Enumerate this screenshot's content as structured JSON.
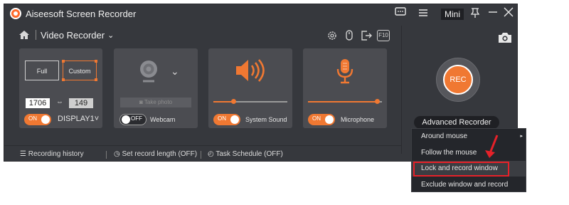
{
  "app": {
    "title": "Aiseesoft Screen Recorder"
  },
  "titlebar": {
    "mini_label": "Mini",
    "icons": [
      "feedback-icon",
      "menu-icon",
      "pin-icon",
      "minimize-icon",
      "close-icon"
    ]
  },
  "nav": {
    "title": "Video Recorder",
    "chevron": "⌄"
  },
  "toolbar": {
    "icons": [
      "settings-icon",
      "mouse-icon",
      "export-icon",
      "f10-icon"
    ],
    "f10_label": "F10"
  },
  "display_card": {
    "full_label": "Full",
    "custom_label": "Custom",
    "width": "1706",
    "height": "149",
    "link_glyph": "⇔",
    "toggle_label": "ON",
    "display_label": "DISPLAY1",
    "display_chev": "˅"
  },
  "webcam_card": {
    "photo_label": "Take photo",
    "toggle_label": "OFF",
    "label": "Webcam",
    "chevron": "⌄"
  },
  "sound_card": {
    "toggle_label": "ON",
    "label": "System Sound",
    "volume_percent": 27
  },
  "mic_card": {
    "toggle_label": "ON",
    "label": "Microphone",
    "volume_percent": 93
  },
  "bottom": {
    "history": "Recording history",
    "record_length": "Set record length (OFF)",
    "task_schedule": "Task Schedule (OFF)"
  },
  "rec_label": "REC",
  "advanced_recorder": "Advanced Recorder",
  "menu": {
    "items": [
      {
        "label": "Around mouse",
        "has_submenu": true
      },
      {
        "label": "Follow the mouse",
        "has_submenu": false
      },
      {
        "label": "Lock and record window",
        "has_submenu": false
      },
      {
        "label": "Exclude window and record",
        "has_submenu": false
      }
    ],
    "submenu_glyph": "▸"
  },
  "colors": {
    "accent": "#f07832",
    "background": "#36383d",
    "card": "#4b4c51",
    "highlight_box": "#e62129"
  }
}
